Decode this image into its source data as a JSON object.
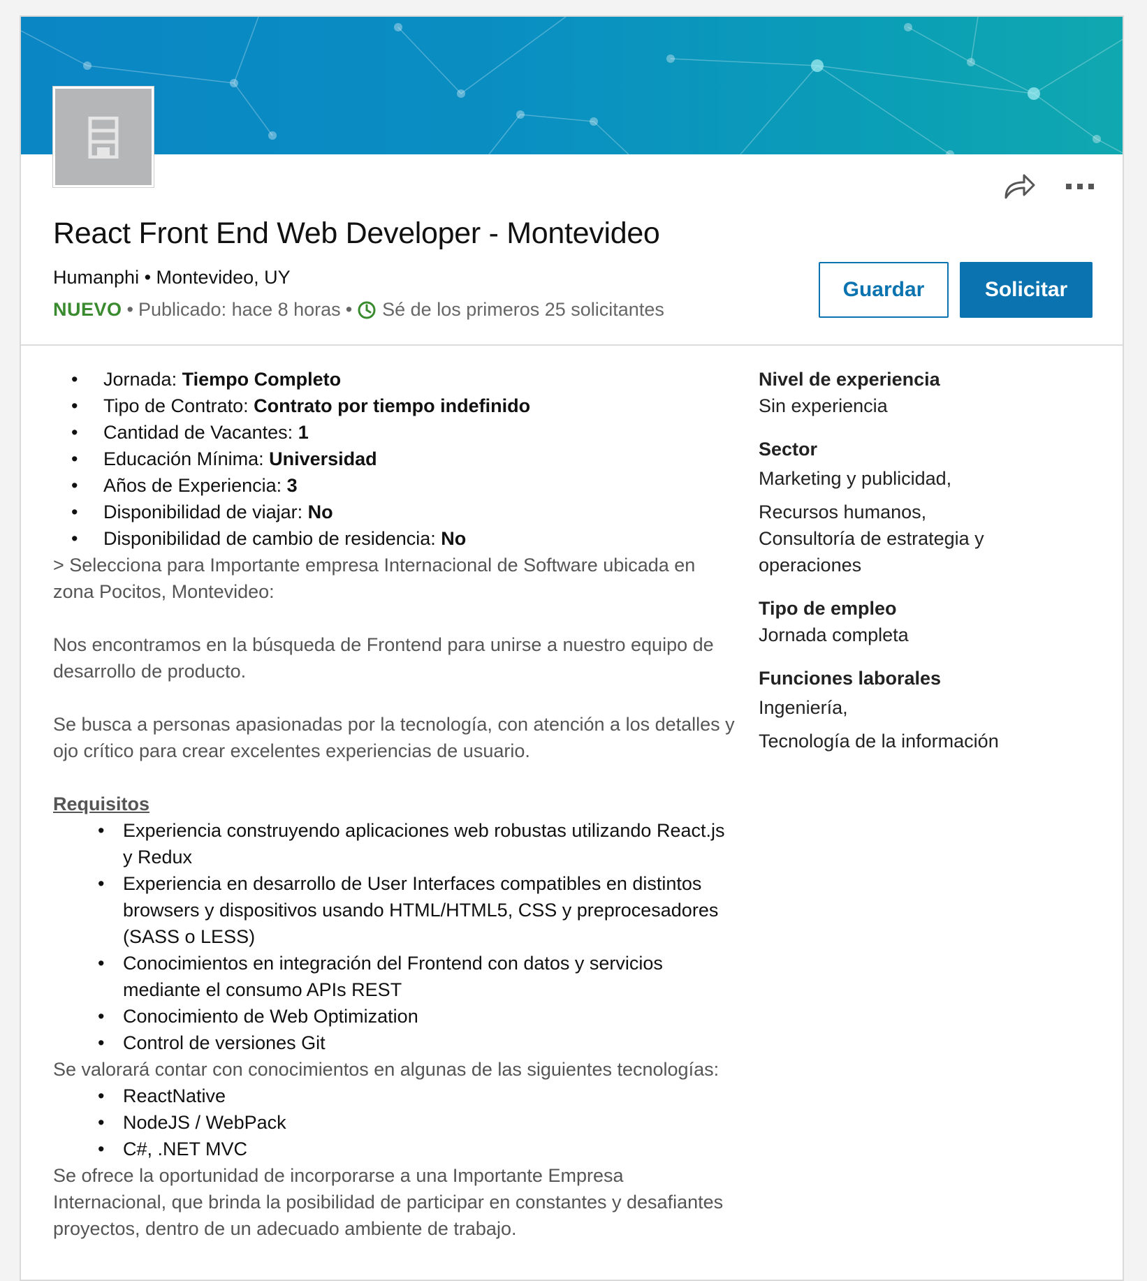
{
  "job": {
    "title": "React Front End Web Developer - Montevideo",
    "company_line": "Humanphi • Montevideo, UY",
    "new_badge": "NUEVO",
    "posted": "Publicado: hace 8 horas",
    "applicants": "Sé de los primeros 25 solicitantes"
  },
  "actions": {
    "save_label": "Guardar",
    "apply_label": "Solicitar",
    "share_icon": "share-icon",
    "more_icon": "more-options-icon"
  },
  "facts": [
    {
      "label": "Jornada: ",
      "value": "Tiempo Completo"
    },
    {
      "label": "Tipo de Contrato: ",
      "value": "Contrato por tiempo indefinido"
    },
    {
      "label": "Cantidad de Vacantes: ",
      "value": "1"
    },
    {
      "label": "Educación Mínima: ",
      "value": "Universidad"
    },
    {
      "label": "Años de Experiencia: ",
      "value": "3"
    },
    {
      "label": "Disponibilidad de viajar: ",
      "value": "No"
    },
    {
      "label": "Disponibilidad de cambio de residencia: ",
      "value": "No"
    }
  ],
  "description": {
    "intro": "> Selecciona para Importante empresa Internacional de Software ubicada en zona Pocitos, Montevideo:",
    "p1": "Nos encontramos en la búsqueda de Frontend para unirse a nuestro equipo de desarrollo de producto.",
    "p2": "Se busca a personas apasionadas por la tecnología, con atención a los detalles y ojo crítico para crear excelentes experiencias de usuario.",
    "requirements_title": "Requisitos",
    "requirements": [
      "Experiencia construyendo aplicaciones web robustas utilizando React.js y Redux",
      "Experiencia en desarrollo de User Interfaces compatibles en distintos browsers y dispositivos usando HTML/HTML5, CSS y preprocesadores (SASS o LESS)",
      "Conocimientos en integración del Frontend con datos y servicios mediante el consumo APIs REST",
      "Conocimiento de Web Optimization",
      "Control de versiones Git"
    ],
    "nice_intro": "Se valorará contar con conocimientos en algunas de las siguientes tecnologías:",
    "nice": [
      "ReactNative",
      "NodeJS / WebPack",
      "C#, .NET MVC"
    ],
    "closing": "Se ofrece la oportunidad de incorporarse a una Importante Empresa Internacional, que brinda la posibilidad de participar en constantes y desafiantes proyectos, dentro de un adecuado ambiente de trabajo."
  },
  "criteria": {
    "experience_title": "Nivel de experiencia",
    "experience_value": "Sin experiencia",
    "sector_title": "Sector",
    "sector_values": [
      "Marketing y publicidad,",
      "Recursos humanos,",
      "Consultoría de estrategia y operaciones"
    ],
    "employment_title": "Tipo de empleo",
    "employment_value": "Jornada completa",
    "functions_title": "Funciones laborales",
    "functions_values": [
      "Ingeniería,",
      "Tecnología de la información"
    ]
  },
  "colors": {
    "accent": "#0b73b0",
    "new_badge": "#3a8a2f",
    "banner_start": "#0a86c4",
    "banner_end": "#10a8b0"
  }
}
